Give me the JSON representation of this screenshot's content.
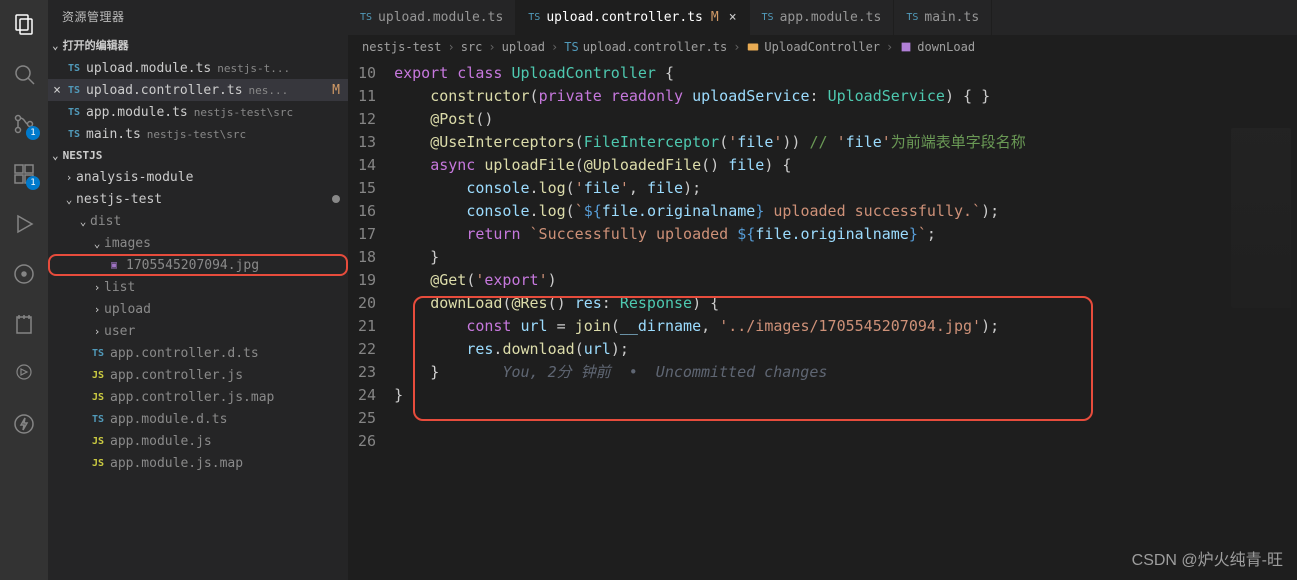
{
  "sidebar": {
    "title": "资源管理器",
    "open_editors_label": "打开的编辑器",
    "open_editors": [
      {
        "icon": "TS",
        "label": "upload.module.ts",
        "meta": "nestjs-t..."
      },
      {
        "icon": "TS",
        "label": "upload.controller.ts",
        "meta": "nes...",
        "modified": "M",
        "active": true
      },
      {
        "icon": "TS",
        "label": "app.module.ts",
        "meta": "nestjs-test\\src"
      },
      {
        "icon": "TS",
        "label": "main.ts",
        "meta": "nestjs-test\\src"
      }
    ],
    "workspace_label": "NESTJS",
    "tree": [
      {
        "depth": 0,
        "chev": "›",
        "label": "analysis-module"
      },
      {
        "depth": 0,
        "chev": "⌄",
        "label": "nestjs-test",
        "dot": true
      },
      {
        "depth": 1,
        "chev": "⌄",
        "label": "dist",
        "dim": true
      },
      {
        "depth": 2,
        "chev": "⌄",
        "label": "images",
        "dim": true
      },
      {
        "depth": 3,
        "icon": "img",
        "label": "1705545207094.jpg",
        "dim": true,
        "hl": true
      },
      {
        "depth": 2,
        "chev": "›",
        "label": "list",
        "dim": true
      },
      {
        "depth": 2,
        "chev": "›",
        "label": "upload",
        "dim": true
      },
      {
        "depth": 2,
        "chev": "›",
        "label": "user",
        "dim": true
      },
      {
        "depth": 2,
        "icon": "TS",
        "label": "app.controller.d.ts",
        "dim": true
      },
      {
        "depth": 2,
        "icon": "JS",
        "label": "app.controller.js",
        "dim": true
      },
      {
        "depth": 2,
        "icon": "JS",
        "label": "app.controller.js.map",
        "dim": true
      },
      {
        "depth": 2,
        "icon": "TS",
        "label": "app.module.d.ts",
        "dim": true
      },
      {
        "depth": 2,
        "icon": "JS",
        "label": "app.module.js",
        "dim": true
      },
      {
        "depth": 2,
        "icon": "JS",
        "label": "app.module.js.map",
        "dim": true
      }
    ]
  },
  "tabs": [
    {
      "icon": "TS",
      "label": "upload.module.ts"
    },
    {
      "icon": "TS",
      "label": "upload.controller.ts",
      "m": "M",
      "active": true,
      "close": true
    },
    {
      "icon": "TS",
      "label": "app.module.ts"
    },
    {
      "icon": "TS",
      "label": "main.ts"
    }
  ],
  "crumbs": {
    "c1": "nestjs-test",
    "c2": "src",
    "c3": "upload",
    "c4": "upload.controller.ts",
    "c5": "UploadController",
    "c6": "downLoad"
  },
  "code": {
    "start": 10,
    "lines": [
      "export class UploadController {",
      "    constructor(private readonly uploadService: UploadService) { }",
      "",
      "    @Post()",
      "    @UseInterceptors(FileInterceptor('file')) // 'file'为前端表单字段名称",
      "    async uploadFile(@UploadedFile() file) {",
      "        console.log('file', file);",
      "        console.log(`${file.originalname} uploaded successfully.`);",
      "        return `Successfully uploaded ${file.originalname}`;",
      "    }",
      "",
      "    @Get('export')",
      "    downLoad(@Res() res: Response) {",
      "        const url = join(__dirname, '../images/1705545207094.jpg');",
      "        res.download(url);",
      "    }       You, 2分 钟前  •  Uncommitted changes",
      "}"
    ]
  },
  "watermark": "CSDN @炉火纯青-旺",
  "badges": {
    "scm": "1",
    "ext": "1"
  }
}
